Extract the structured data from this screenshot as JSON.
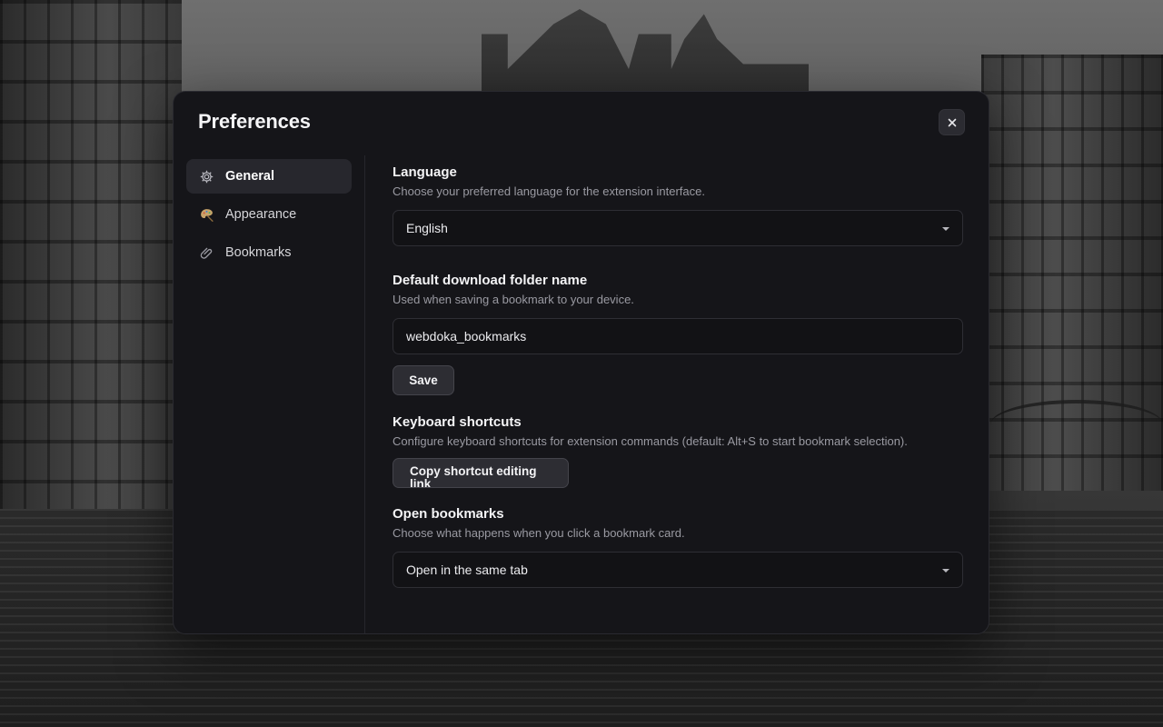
{
  "dialog": {
    "title": "Preferences",
    "close_icon": "close-icon"
  },
  "sidebar": {
    "items": [
      {
        "label": "General",
        "icon": "gear-icon",
        "active": true
      },
      {
        "label": "Appearance",
        "icon": "palette-icon",
        "active": false
      },
      {
        "label": "Bookmarks",
        "icon": "paperclip-icon",
        "active": false
      }
    ]
  },
  "settings": {
    "language": {
      "title": "Language",
      "description": "Choose your preferred language for the extension interface.",
      "value": "English"
    },
    "download_folder": {
      "title": "Default download folder name",
      "description": "Used when saving a bookmark to your device.",
      "value": "webdoka_bookmarks",
      "save_label": "Save"
    },
    "keyboard_shortcuts": {
      "title": "Keyboard shortcuts",
      "description": "Configure keyboard shortcuts for extension commands (default: Alt+S to start bookmark selection).",
      "button_label": "Copy shortcut editing link"
    },
    "open_bookmarks": {
      "title": "Open bookmarks",
      "description": "Choose what happens when you click a bookmark card.",
      "value": "Open in the same tab"
    }
  },
  "colors": {
    "dialog_bg": "#151519",
    "active_nav_bg": "#27272d",
    "input_bg": "#121215",
    "muted_text": "#9a9aa2"
  }
}
